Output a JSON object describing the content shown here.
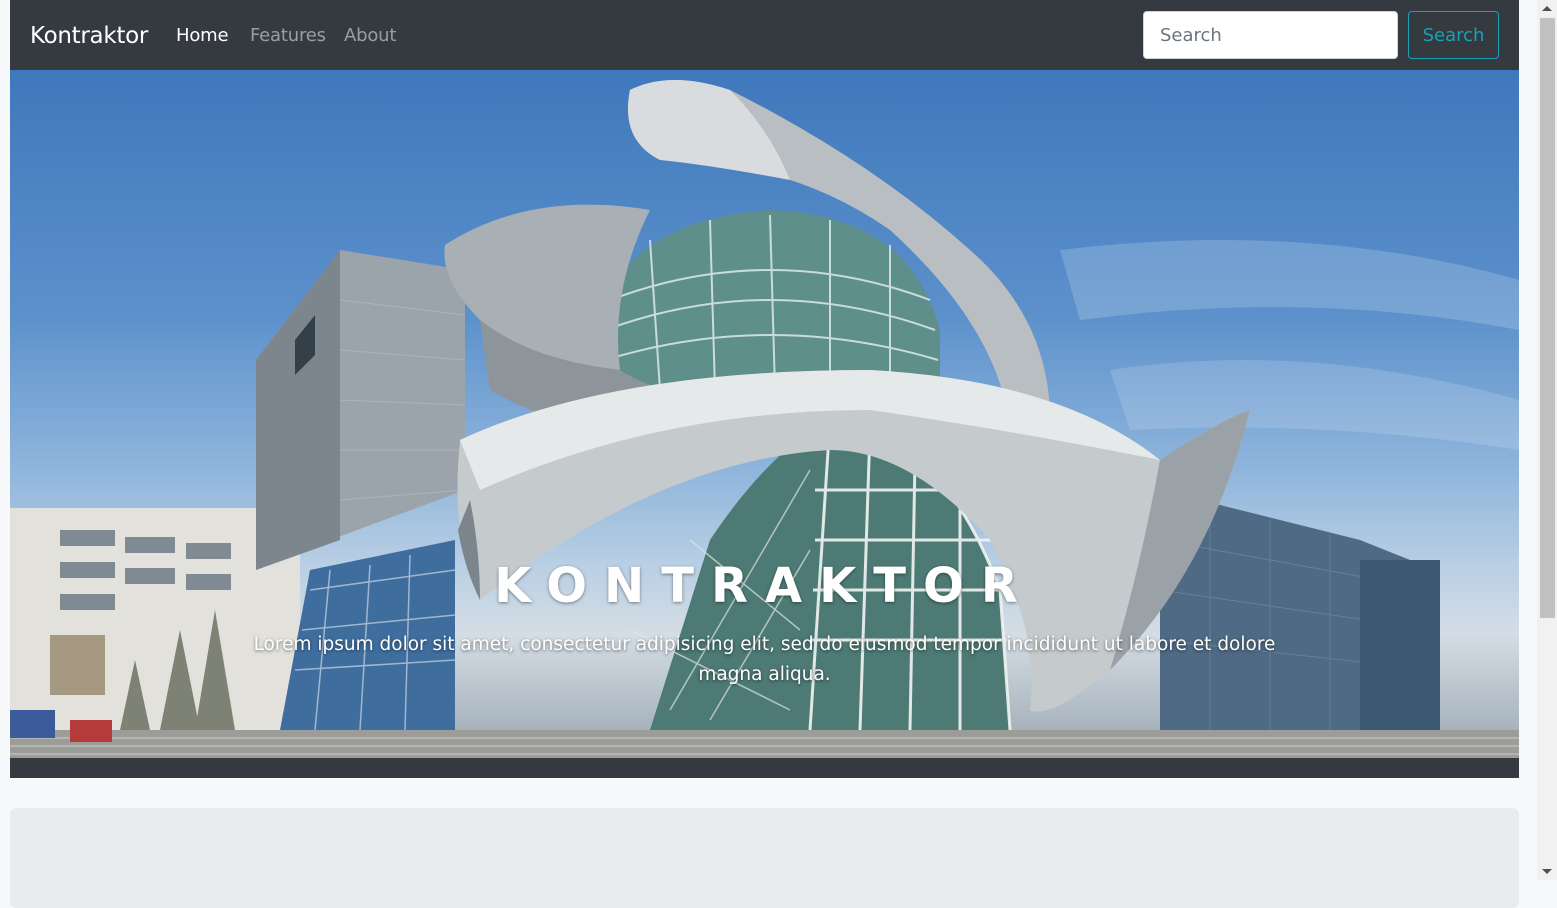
{
  "navbar": {
    "brand": "Kontraktor",
    "links": [
      {
        "label": "Home",
        "active": true
      },
      {
        "label": "Features",
        "active": false
      },
      {
        "label": "About",
        "active": false
      }
    ],
    "search": {
      "placeholder": "Search",
      "value": "",
      "button_label": "Search"
    }
  },
  "hero": {
    "title": "KONTRAKTOR",
    "text": "Lorem ipsum dolor sit amet, consectetur adipisicing elit, sed do eiusmod tempor incididunt ut labore et dolore magna aliqua.",
    "image_subject": "modern-art-gallery-building"
  },
  "colors": {
    "navbar_bg": "#343a40",
    "accent_info": "#17a2b8",
    "page_bg": "#f8f9fa",
    "jumbotron_bg": "#e9ecef"
  }
}
